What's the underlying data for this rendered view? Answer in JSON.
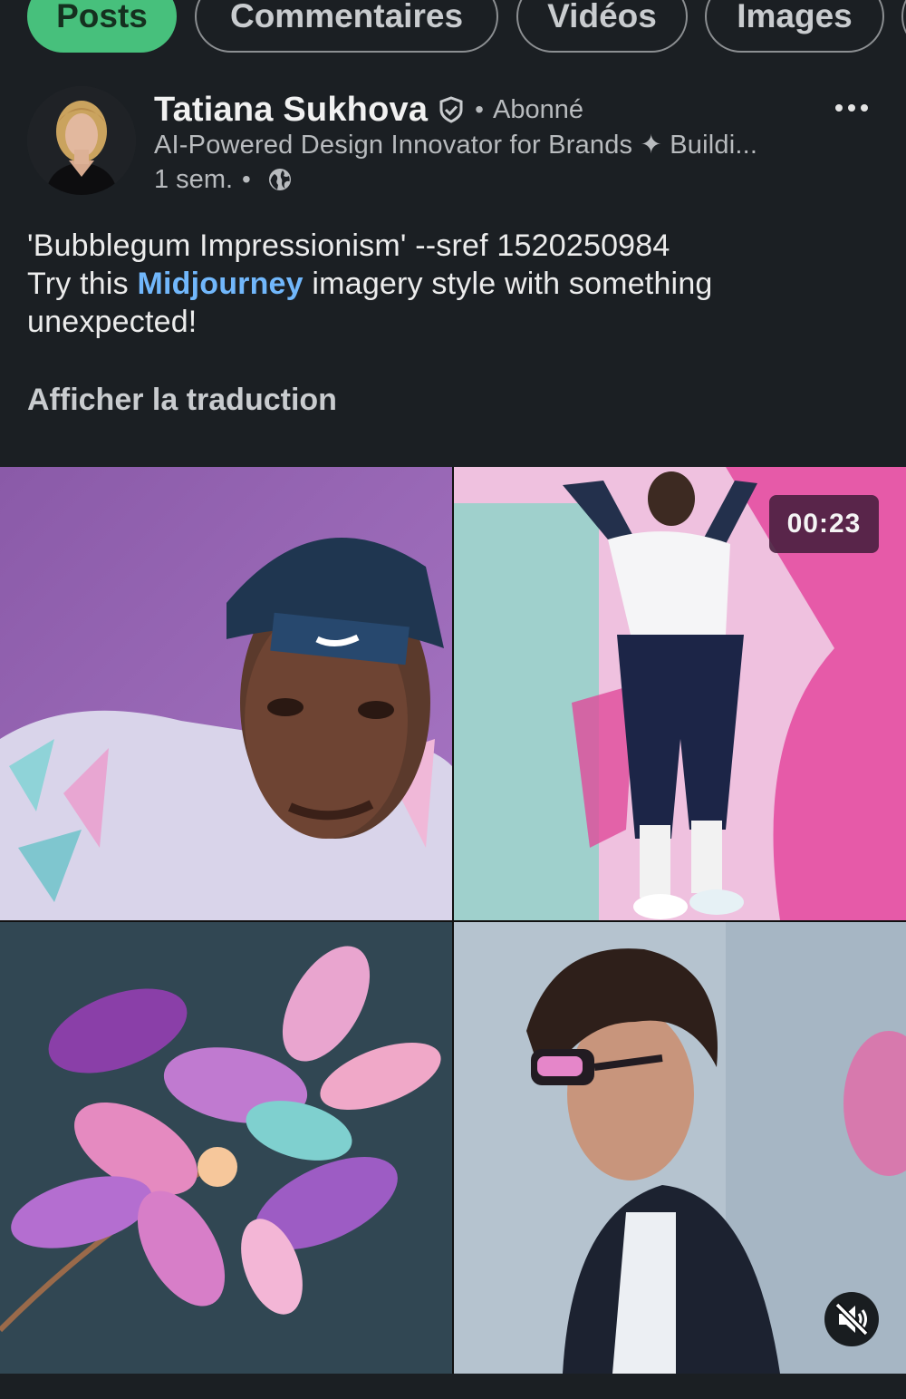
{
  "filters": {
    "posts": "Posts",
    "comments": "Commentaires",
    "videos": "Vidéos",
    "images": "Images"
  },
  "post": {
    "author": "Tatiana Sukhova",
    "follow_status": "Abonné",
    "headline": "AI-Powered Design Innovator for Brands ✦ Buildi...",
    "age": "1 sem.",
    "text_line1": "'Bubblegum Impressionism' --sref 1520250984",
    "text_try": "Try this ",
    "text_link": "Midjourney",
    "text_rest": " imagery style with something unexpected!",
    "translate_label": "Afficher la traduction"
  },
  "media": {
    "duration": "00:23"
  },
  "icons": {
    "verified": "shield-check-icon",
    "more": "ellipsis-icon",
    "visibility": "globe-icon",
    "mute": "speaker-muted-icon"
  },
  "colors": {
    "background": "#1b1f23",
    "active_chip": "#47c07c",
    "link": "#71b7fb"
  }
}
